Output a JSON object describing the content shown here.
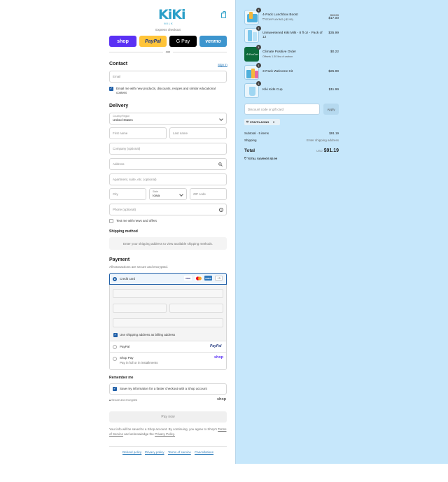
{
  "brand": {
    "logo": "KiKi",
    "logo_sub": "MILK"
  },
  "express": {
    "label": "Express checkout",
    "buttons": [
      "shop",
      "PayPal",
      "G Pay",
      "venmo"
    ],
    "or": "OR"
  },
  "contact": {
    "title": "Contact",
    "signin": "Sign in",
    "email_placeholder": "Email",
    "newsletter": "Email me with new products, discounts, recipes and similar educational content"
  },
  "delivery": {
    "title": "Delivery",
    "country_label": "Country/Region",
    "country": "United States",
    "first_name": "First name",
    "last_name": "Last name",
    "company": "Company (optional)",
    "address": "Address",
    "apartment": "Apartment, suite, etc. (optional)",
    "city": "City",
    "state_label": "State",
    "state": "Iowa",
    "zip": "ZIP code",
    "phone": "Phone (optional)",
    "text_me": "Text me with news and offers"
  },
  "shipping": {
    "title": "Shipping method",
    "note": "Enter your shipping address to view available shipping methods."
  },
  "payment": {
    "title": "Payment",
    "subtitle": "All transactions are secure and encrypted.",
    "credit_card": "Credit card",
    "card_badges": [
      "VISA",
      "MC",
      "AMEX"
    ],
    "more": "+3",
    "billing_same": "Use shipping address as billing address",
    "paypal": "PayPal",
    "shop_pay": "Shop Pay",
    "shop_pay_sub": "Pay in full or in installments",
    "shop_logo": "shop"
  },
  "remember": {
    "title": "Remember me",
    "save": "Save my information for a faster checkout with a Shop account",
    "secure": "Secure and encrypted",
    "shop": "shop"
  },
  "pay_now": "Pay now",
  "legal": {
    "line1": "Your info will be saved to a Shop account. By continuing, you agree to Shop's",
    "tos": "Terms of Service",
    "and": "and acknowledge the",
    "privacy": "Privacy Policy."
  },
  "footer_links": [
    "Refund policy",
    "Privacy policy",
    "Terms of service",
    "Cancellations"
  ],
  "order": {
    "items": [
      {
        "qty": "1",
        "name": "4-Pack Lunchbox Boost",
        "sub": "STAYPLAYING (-$2.99)",
        "old": "$19.99",
        "price": "$17.00"
      },
      {
        "qty": "1",
        "name": "Unsweetened Kiki Milk - 8 fl oz - Pack of 12",
        "sub": "",
        "old": "",
        "price": "$35.99"
      },
      {
        "qty": "1",
        "name": "Climate Positive Order",
        "sub": "Offsets 1.30 lbs of carbon",
        "old": "",
        "price": "$0.22"
      },
      {
        "qty": "1",
        "name": "3-Pack Welcome Kit",
        "sub": "",
        "old": "",
        "price": "$25.99"
      },
      {
        "qty": "1",
        "name": "Kiki Kids Cup",
        "sub": "",
        "old": "",
        "price": "$11.99"
      }
    ],
    "discount_placeholder": "Discount code or gift card",
    "apply": "Apply",
    "code": "STAYPLAYING",
    "subtotal_label": "Subtotal · 5 items",
    "subtotal": "$91.19",
    "shipping_label": "Shipping",
    "shipping_value": "Enter shipping address",
    "total_label": "Total",
    "currency": "USD",
    "total": "$91.19",
    "savings_label": "TOTAL SAVINGS",
    "savings": "$2.99"
  },
  "colors": {
    "accent": "#1f5fa8",
    "shop": "#5a31f4",
    "paypal": "#ffc439",
    "gpay": "#000000",
    "venmo": "#3d95ce",
    "sidebar": "#c6e7fb"
  }
}
